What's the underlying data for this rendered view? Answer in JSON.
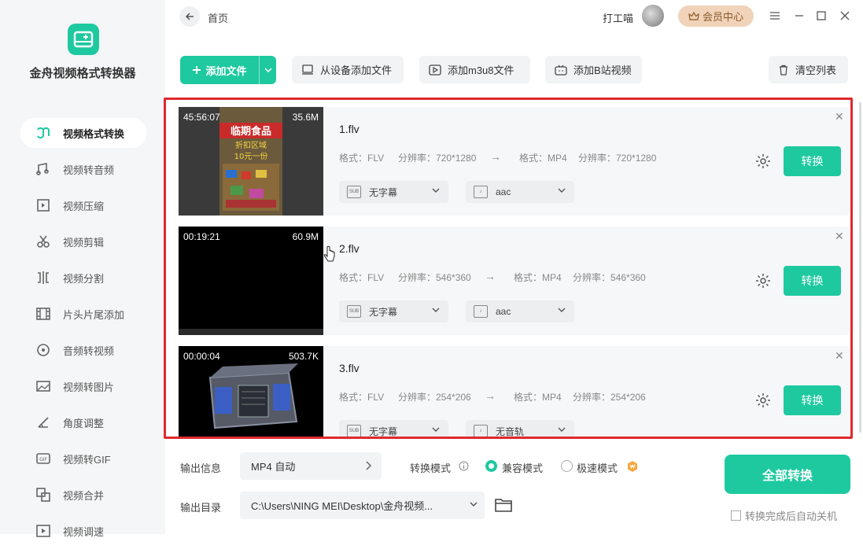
{
  "app": {
    "name": "金舟视频格式转换器",
    "accent": "#1ec9a0"
  },
  "sidebar": {
    "items": [
      {
        "label": "视频格式转换",
        "icon": "video-convert-icon",
        "active": true
      },
      {
        "label": "视频转音频",
        "icon": "audio-note-icon"
      },
      {
        "label": "视频压缩",
        "icon": "compress-icon"
      },
      {
        "label": "视频剪辑",
        "icon": "scissors-icon"
      },
      {
        "label": "视频分割",
        "icon": "split-icon"
      },
      {
        "label": "片头片尾添加",
        "icon": "film-icon"
      },
      {
        "label": "音频转视频",
        "icon": "disc-icon"
      },
      {
        "label": "视频转图片",
        "icon": "image-icon"
      },
      {
        "label": "角度调整",
        "icon": "rotate-icon"
      },
      {
        "label": "视频转GIF",
        "icon": "gif-icon"
      },
      {
        "label": "视频合并",
        "icon": "merge-icon"
      },
      {
        "label": "视频调速",
        "icon": "speed-icon"
      }
    ]
  },
  "header": {
    "breadcrumb": "首页",
    "username": "打工喵",
    "vip_label": "会员中心"
  },
  "toolbar": {
    "add_file": "添加文件",
    "add_device": "从设备添加文件",
    "add_m3u8": "添加m3u8文件",
    "add_bilibili": "添加B站视频",
    "clear_list": "清空列表"
  },
  "files": [
    {
      "name": "1.flv",
      "duration": "45:56:07",
      "size": "35.6M",
      "src_format": "格式：FLV",
      "src_res": "分辨率：720*1280",
      "dst_format": "格式：MP4",
      "dst_res": "分辨率：720*1280",
      "subtitle": "无字幕",
      "audio": "aac",
      "convert": "转换"
    },
    {
      "name": "2.flv",
      "duration": "00:19:21",
      "size": "60.9M",
      "src_format": "格式：FLV",
      "src_res": "分辨率：546*360",
      "dst_format": "格式：MP4",
      "dst_res": "分辨率：546*360",
      "subtitle": "无字幕",
      "audio": "aac",
      "convert": "转换"
    },
    {
      "name": "3.flv",
      "duration": "00:00:04",
      "size": "503.7K",
      "src_format": "格式：FLV",
      "src_res": "分辨率：254*206",
      "dst_format": "格式：MP4",
      "dst_res": "分辨率：254*206",
      "subtitle": "无字幕",
      "audio": "无音轨",
      "convert": "转换"
    }
  ],
  "thumb1": {
    "sign_title": "临期食品",
    "sign_sub": "折扣区域",
    "sign_price": "10元一份"
  },
  "bottom": {
    "output_info_label": "输出信息",
    "output_format": "MP4 自动",
    "mode_label": "转换模式",
    "mode_compat": "兼容模式",
    "mode_fast": "极速模式",
    "output_dir_label": "输出目录",
    "output_dir": "C:\\Users\\NING MEI\\Desktop\\金舟视频...",
    "convert_all": "全部转换",
    "auto_shutdown": "转换完成后自动关机"
  }
}
